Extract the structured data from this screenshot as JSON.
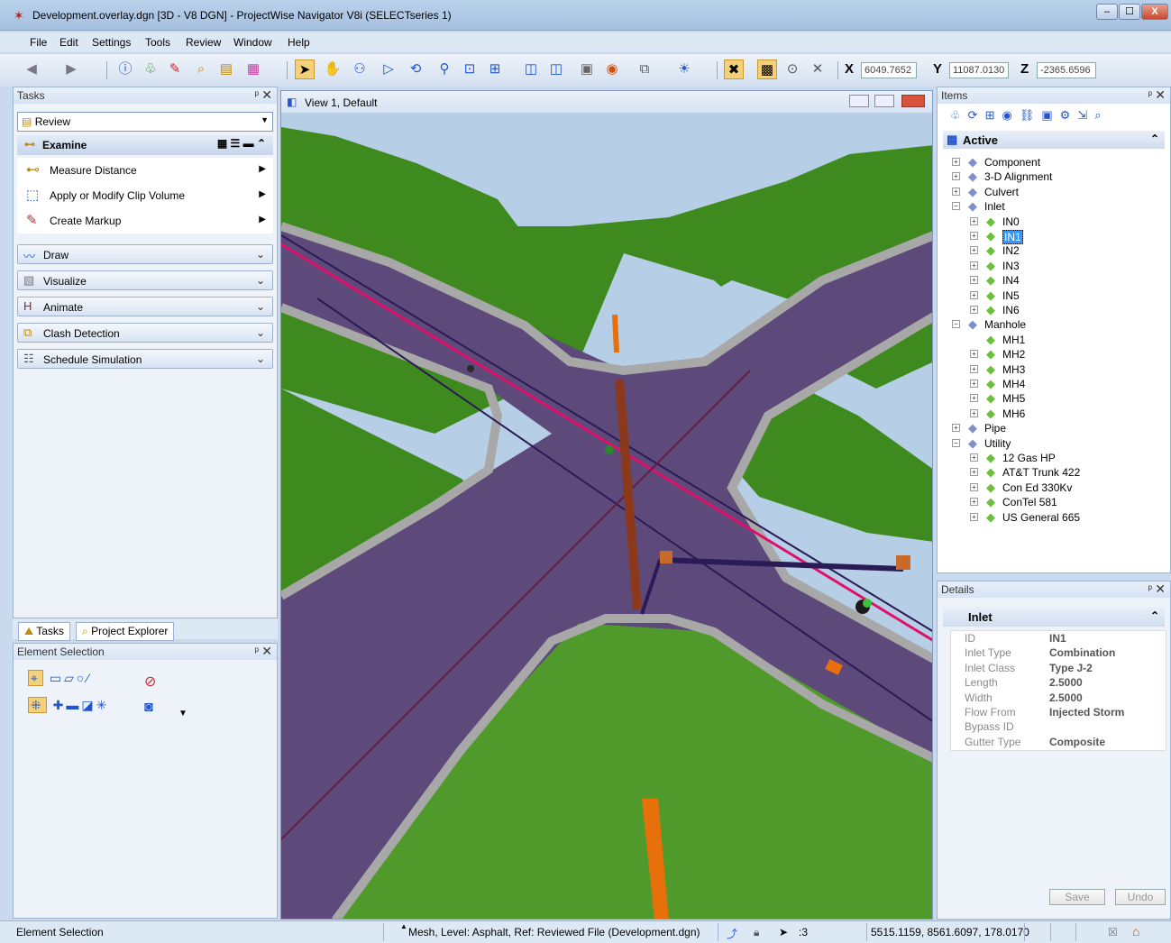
{
  "window": {
    "title": "Development.overlay.dgn [3D - V8 DGN] - ProjectWise Navigator V8i (SELECTseries 1)",
    "minimize": "‒",
    "maximize": "☐",
    "close": "X"
  },
  "menu": [
    "File",
    "Edit",
    "Settings",
    "Tools",
    "Review",
    "Window",
    "Help"
  ],
  "coords": {
    "x_label": "X",
    "x_value": "6049.7652",
    "y_label": "Y",
    "y_value": "11087.0130",
    "z_label": "Z",
    "z_value": "-2365.6596"
  },
  "tasks_panel": {
    "title": "Tasks",
    "review_select": "Review",
    "examine": {
      "title": "Examine",
      "items": [
        "Measure Distance",
        "Apply or Modify Clip Volume",
        "Create Markup"
      ]
    },
    "groups": [
      "Draw",
      "Visualize",
      "Animate",
      "Clash Detection",
      "Schedule Simulation"
    ],
    "tabs": [
      "Tasks",
      "Project Explorer"
    ]
  },
  "element_selection": {
    "title": "Element Selection"
  },
  "view": {
    "title": "View 1, Default"
  },
  "items_panel": {
    "title": "Items",
    "active": "Active",
    "tree": [
      {
        "label": "Component",
        "level": 0,
        "expand": "+"
      },
      {
        "label": "3-D Alignment",
        "level": 0,
        "expand": "+"
      },
      {
        "label": "Culvert",
        "level": 0,
        "expand": "+"
      },
      {
        "label": "Inlet",
        "level": 0,
        "expand": "−"
      },
      {
        "label": "IN0",
        "level": 1,
        "expand": "+"
      },
      {
        "label": "IN1",
        "level": 1,
        "expand": "+",
        "selected": true
      },
      {
        "label": "IN2",
        "level": 1,
        "expand": "+"
      },
      {
        "label": "IN3",
        "level": 1,
        "expand": "+"
      },
      {
        "label": "IN4",
        "level": 1,
        "expand": "+"
      },
      {
        "label": "IN5",
        "level": 1,
        "expand": "+"
      },
      {
        "label": "IN6",
        "level": 1,
        "expand": "+"
      },
      {
        "label": "Manhole",
        "level": 0,
        "expand": "−"
      },
      {
        "label": "MH1",
        "level": 1,
        "expand": ""
      },
      {
        "label": "MH2",
        "level": 1,
        "expand": "+"
      },
      {
        "label": "MH3",
        "level": 1,
        "expand": "+"
      },
      {
        "label": "MH4",
        "level": 1,
        "expand": "+"
      },
      {
        "label": "MH5",
        "level": 1,
        "expand": "+"
      },
      {
        "label": "MH6",
        "level": 1,
        "expand": "+"
      },
      {
        "label": "Pipe",
        "level": 0,
        "expand": "+"
      },
      {
        "label": "Utility",
        "level": 0,
        "expand": "−"
      },
      {
        "label": "12 Gas HP",
        "level": 1,
        "expand": "+"
      },
      {
        "label": "AT&T Trunk 422",
        "level": 1,
        "expand": "+"
      },
      {
        "label": "Con Ed 330Kv",
        "level": 1,
        "expand": "+"
      },
      {
        "label": "ConTel 581",
        "level": 1,
        "expand": "+"
      },
      {
        "label": "US General 665",
        "level": 1,
        "expand": "+"
      }
    ]
  },
  "details_panel": {
    "title": "Details",
    "section": "Inlet",
    "rows": [
      {
        "key": "ID",
        "value": "IN1"
      },
      {
        "key": "Inlet Type",
        "value": "Combination"
      },
      {
        "key": "Inlet Class",
        "value": "Type J-2"
      },
      {
        "key": "Length",
        "value": "2.5000"
      },
      {
        "key": "Width",
        "value": "2.5000"
      },
      {
        "key": "Flow From",
        "value": "Injected Storm"
      },
      {
        "key": "Bypass ID",
        "value": ""
      },
      {
        "key": "Gutter Type",
        "value": "Composite"
      }
    ],
    "save": "Save",
    "undo": "Undo"
  },
  "status": {
    "left": "Element Selection",
    "middle": "Mesh, Level: Asphalt, Ref: Reviewed File (Development.dgn)",
    "count": ":3",
    "coords": "5515.1159, 8561.6097, 178.0170"
  },
  "colors": {
    "asphalt": "#5e4a7a",
    "grass": "#3f8a1e",
    "sky": "#b7cfe6",
    "curb": "#a8a8a8",
    "pipe_red": "#e0106a",
    "pipe_orange": "#e8700a"
  }
}
